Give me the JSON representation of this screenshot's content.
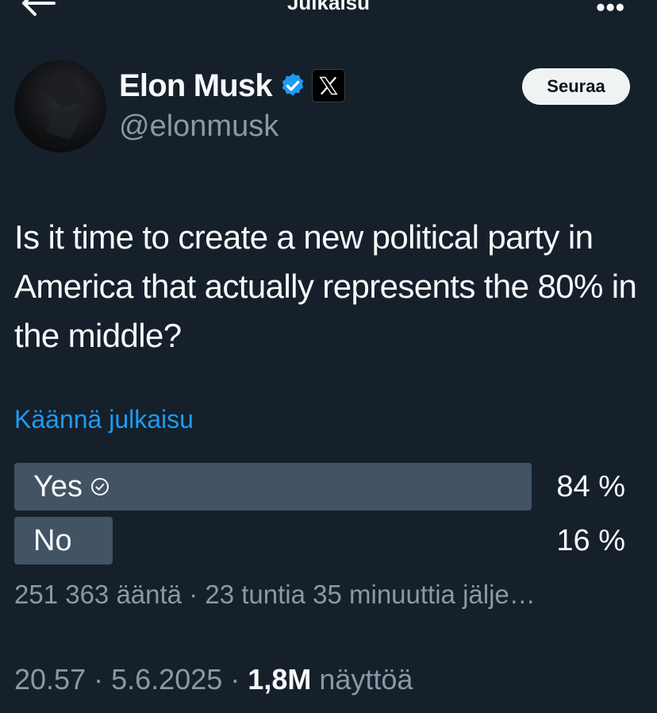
{
  "header": {
    "title": "Julkaisu",
    "back_icon": "arrow-left-icon",
    "more_icon": "more-icon"
  },
  "author": {
    "name": "Elon Musk",
    "handle": "@elonmusk",
    "verified_color": "#1d9bf0",
    "affiliation_badge": "x-logo-icon",
    "follow_label": "Seuraa"
  },
  "post": {
    "text": "Is it time to create a new political party in America that actually represents the 80% in the middle?",
    "translate_label": "Käännä julkaisu"
  },
  "poll": {
    "options": [
      {
        "label": "Yes",
        "percent_text": "84 %",
        "percent": 84,
        "selected": true
      },
      {
        "label": "No",
        "percent_text": "16 %",
        "percent": 16,
        "selected": false
      }
    ],
    "meta": "251 363 ääntä · 23 tuntia 35 minuuttia jälje…"
  },
  "post_meta": {
    "time": "20.57",
    "separator": "·",
    "date": "5.6.2025",
    "views_count": "1,8M",
    "views_label": "näyttöä"
  },
  "colors": {
    "background": "#15202b",
    "poll_bar": "#425364",
    "accent": "#1d9bf0",
    "muted": "#8b98a5"
  }
}
